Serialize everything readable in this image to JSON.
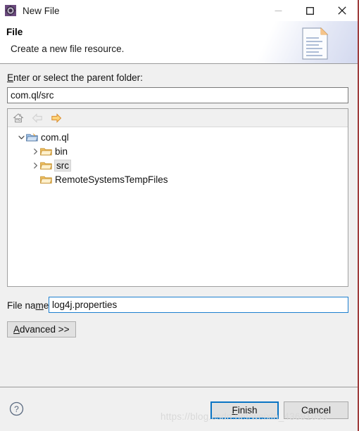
{
  "window": {
    "title": "New File",
    "icon": "eclipse-wizard-icon",
    "controls": [
      {
        "name": "minimize-button",
        "glyph": "minimize",
        "enabled": false
      },
      {
        "name": "maximize-button",
        "glyph": "maximize",
        "enabled": true
      },
      {
        "name": "close-button",
        "glyph": "close",
        "enabled": true
      }
    ]
  },
  "header": {
    "title": "File",
    "description": "Create a new file resource.",
    "icon": "new-file-document-icon"
  },
  "parent_folder": {
    "label_prefix": "E",
    "label_rest": "nter or select the parent folder:",
    "value": "com.ql/src",
    "placeholder": ""
  },
  "tree_toolbar": {
    "items": [
      {
        "name": "home-icon",
        "label": "Home",
        "enabled": true
      },
      {
        "name": "back-arrow-icon",
        "label": "Back",
        "enabled": false
      },
      {
        "name": "forward-arrow-icon",
        "label": "Forward",
        "enabled": true
      }
    ]
  },
  "tree": {
    "nodes": [
      {
        "label": "com.ql",
        "indent": 0,
        "expanded": true,
        "has_children": true,
        "icon": "project-folder-icon",
        "selected": false
      },
      {
        "label": "bin",
        "indent": 1,
        "expanded": false,
        "has_children": true,
        "icon": "folder-icon",
        "selected": false
      },
      {
        "label": "src",
        "indent": 1,
        "expanded": false,
        "has_children": true,
        "icon": "folder-icon",
        "selected": true
      },
      {
        "label": "RemoteSystemsTempFiles",
        "indent": 1,
        "expanded": false,
        "has_children": false,
        "icon": "folder-icon",
        "selected": false
      }
    ]
  },
  "file_name": {
    "label_before": "File na",
    "label_mnemonic": "m",
    "label_after": "e:",
    "value": "log4j.properties"
  },
  "advanced_button": {
    "mnemonic": "A",
    "label_rest": "dvanced >>"
  },
  "footer": {
    "help_label": "?",
    "finish": {
      "mnemonic": "F",
      "label_rest": "inish"
    },
    "cancel": {
      "label": "Cancel"
    }
  },
  "watermark": {
    "text": "https://blog.csdn.net/weixin_43691053"
  },
  "colors": {
    "accent_blue": "#0a74c4",
    "focus_border": "#1d7fd0",
    "dialog_bg": "#f0f0f0",
    "field_bg": "#ffffff",
    "right_border": "#9e3b3b",
    "folder_yellow": "#f3c25c",
    "arrow_orange": "#e8a416"
  }
}
